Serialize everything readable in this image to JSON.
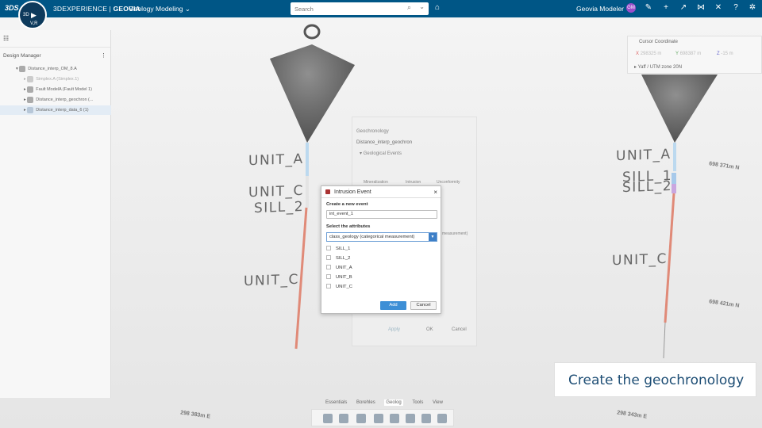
{
  "topbar": {
    "ds_logo": "3DS",
    "compass_top": "3D",
    "compass_bottom": "V,R",
    "brand_prefix": "3DEXPERIENCE | ",
    "brand_name": "GEOVIA",
    "app_name": "Geology Modeling",
    "search_placeholder": "Search",
    "user_name": "Geovia Modeler",
    "user_initials": "GM"
  },
  "design_manager": {
    "title": "Design Manager",
    "items": [
      {
        "label": "Distance_interp_OM_8.A"
      },
      {
        "label": "Simplex.A (Simplex.1)"
      },
      {
        "label": "Fault ModelA (Fault Model 1)"
      },
      {
        "label": "Distance_interp_geochron (..."
      },
      {
        "label": "Distance_interp_data_6 (1)"
      }
    ]
  },
  "viewport": {
    "labels_left": [
      "UNIT_A",
      "UNIT_C",
      "SILL_2",
      "UNIT_C"
    ],
    "labels_right": [
      "UNIT_A",
      "SILL_1",
      "SILL_2",
      "UNIT_C"
    ],
    "coords": [
      "698 371m N",
      "698 421m N",
      "298 383m E",
      "298 343m E"
    ]
  },
  "cursor_panel": {
    "title": "Cursor Coordinate",
    "x_label": "X",
    "x_value": "298325 m",
    "y_label": "Y",
    "y_value": "698387 m",
    "z_label": "Z",
    "z_value": "-15 m",
    "crs": "Yaff / UTM zone 20N"
  },
  "geochronology": {
    "title": "Geochronology",
    "name": "Distance_interp_geochron",
    "section": "Geological Events",
    "events": [
      "Mineralization",
      "Intrusion",
      "Unconformity"
    ],
    "measurement": "measurement)",
    "apply": "Apply",
    "ok": "OK",
    "cancel": "Cancel"
  },
  "intrusion_dialog": {
    "title": "Intrusion Event",
    "name_label": "Create a new event",
    "name_value": "int_event_1",
    "attr_label": "Select the attributes",
    "attr_value": "class_geology (categorical measurement)",
    "options": [
      "SILL_1",
      "SILL_2",
      "UNIT_A",
      "UNIT_B",
      "UNIT_C"
    ],
    "add_label": "Add",
    "cancel_label": "Cancel"
  },
  "callout": {
    "text": "Create the geochronology"
  },
  "bottom_tabs": [
    "Essentials",
    "Borehles",
    "Geolog",
    "Tools",
    "View"
  ],
  "colors": {
    "topbar": "#005686",
    "accent": "#3d8fd6",
    "callout_text": "#1e4e75"
  }
}
